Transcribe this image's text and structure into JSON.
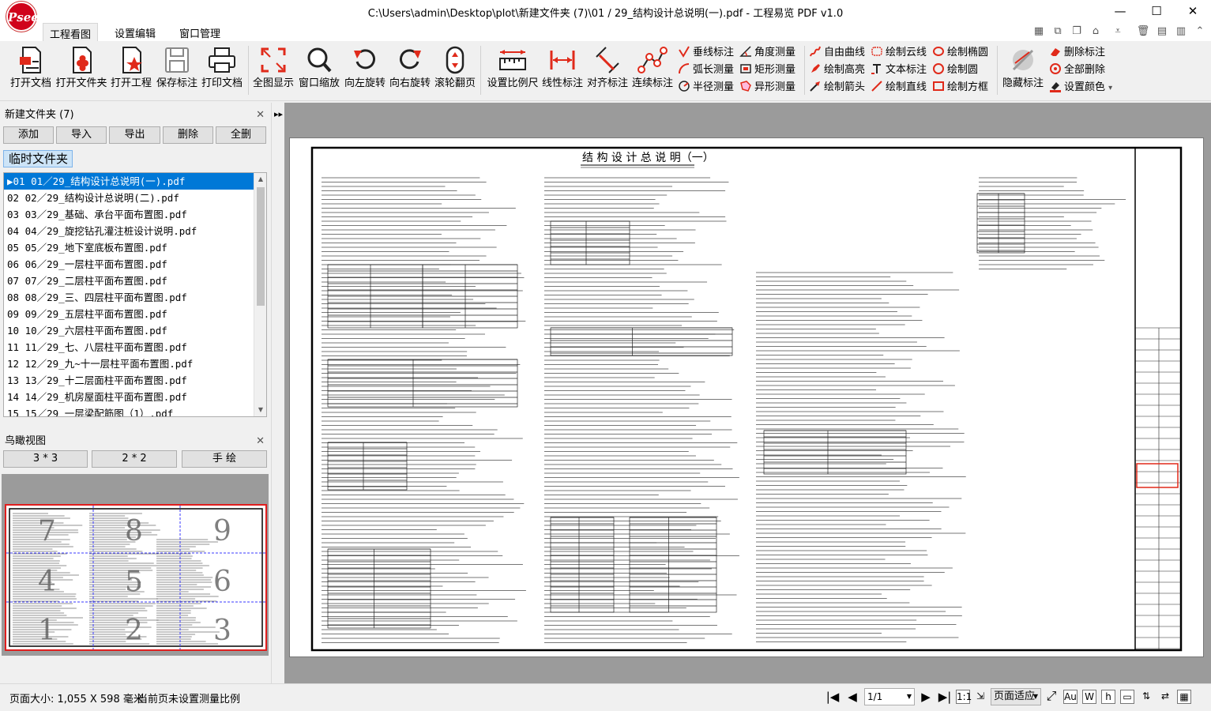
{
  "app": {
    "logo_text": "Psee",
    "title": "C:\\Users\\admin\\Desktop\\plot\\新建文件夹 (7)\\01 / 29_结构设计总说明(一).pdf - 工程易览 PDF v1.0",
    "window_controls": [
      "—",
      "☐",
      "✕"
    ]
  },
  "menu": {
    "items": [
      "工程看图",
      "设置编辑",
      "窗口管理"
    ]
  },
  "ribbon": {
    "file_group": [
      "打开文档",
      "打开文件夹",
      "打开工程",
      "保存标注",
      "打印文档"
    ],
    "view_group": [
      "全图显示",
      "窗口缩放",
      "向左旋转",
      "向右旋转",
      "滚轮翻页"
    ],
    "measure_group": [
      "设置比例尺",
      "线性标注",
      "对齐标注",
      "连续标注"
    ],
    "measure_small": [
      "垂线标注",
      "角度测量",
      "弧长测量",
      "矩形测量",
      "半径测量",
      "异形测量"
    ],
    "draw_small": [
      "自由曲线",
      "绘制云线",
      "绘制椭圆",
      "绘制高亮",
      "文本标注",
      "绘制圆",
      "绘制箭头",
      "绘制直线",
      "绘制方框"
    ],
    "hide_group": [
      "隐藏标注"
    ],
    "manage_small": [
      "删除标注",
      "全部删除",
      "设置颜色"
    ],
    "dropdown_glyph": "▾"
  },
  "left_panel": {
    "folder_title": "新建文件夹 (7)",
    "close_glyph": "✕",
    "buttons": [
      "添加",
      "导入",
      "导出",
      "删除",
      "全删"
    ],
    "temp_tab": "临时文件夹",
    "files": [
      "▶01 01／29_结构设计总说明(一).pdf",
      "02  02／29_结构设计总说明(二).pdf",
      "03  03／29_基础、承台平面布置图.pdf",
      "04  04／29_旋挖钻孔灌注桩设计说明.pdf",
      "05  05／29_地下室底板布置图.pdf",
      "06  06／29_一层柱平面布置图.pdf",
      "07  07／29_二层柱平面布置图.pdf",
      "08  08／29_三、四层柱平面布置图.pdf",
      "09  09／29_五层柱平面布置图.pdf",
      "10  10／29_六层柱平面布置图.pdf",
      "11  11／29_七、八层柱平面布置图.pdf",
      "12  12／29_九~十一层柱平面布置图.pdf",
      "13  13／29_十二层面柱平面布置图.pdf",
      "14  14／29_机房屋面柱平面布置图.pdf",
      "15  15／29_一层梁配筋图（1）.pdf"
    ],
    "birdview_title": "鸟瞰视图",
    "birdview_buttons": [
      "3 * 3",
      "2 * 2",
      "手 绘"
    ],
    "grid_numbers": [
      "7",
      "8",
      "9",
      "4",
      "5",
      "6",
      "1",
      "2",
      "3"
    ]
  },
  "viewer": {
    "drawing_title": "结 构 设 计 总 说 明（一）"
  },
  "status": {
    "page_size": "页面大小: 1,055 X 598 毫米",
    "scale_note": "当前页未设置测量比例",
    "page_field": "1/1",
    "zoom_mode": "页面适应",
    "nav_first": "|◀",
    "nav_prev": "◀",
    "nav_next": "▶",
    "nav_last": "▶|",
    "splitter_glyph": "▸▸"
  }
}
